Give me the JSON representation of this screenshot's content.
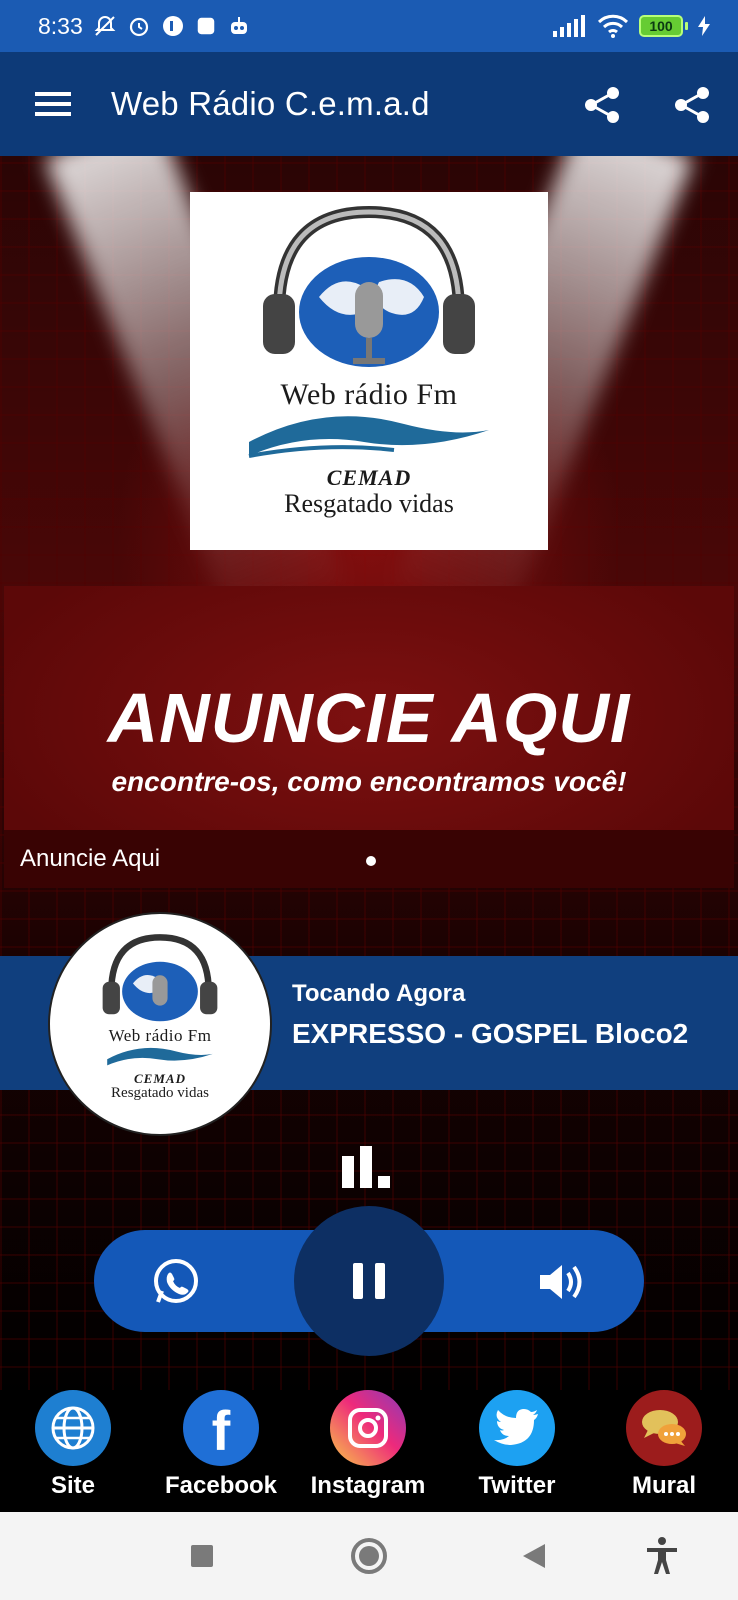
{
  "status_bar": {
    "time": "8:33",
    "battery": "100"
  },
  "app_bar": {
    "title": "Web Rádio C.e.m.a.d"
  },
  "logo": {
    "line1": "Web rádio  Fm",
    "line2": "CEMAD",
    "line3": "Resgatado vidas"
  },
  "banner": {
    "headline": "ANUNCIE AQUI",
    "subline": "encontre-os, como encontramos você!",
    "caption": "Anuncie Aqui"
  },
  "now_playing": {
    "label": "Tocando Agora",
    "title": "EXPRESSO - GOSPEL Bloco2"
  },
  "social": [
    {
      "label": "Site",
      "color": "#1e7fd1",
      "icon": "globe-icon"
    },
    {
      "label": "Facebook",
      "color": "#1f6fd6",
      "icon": "facebook-icon"
    },
    {
      "label": "Instagram",
      "color": "#e1306c",
      "icon": "instagram-icon"
    },
    {
      "label": "Twitter",
      "color": "#1da1f2",
      "icon": "twitter-icon"
    },
    {
      "label": "Mural",
      "color": "#9c1c1c",
      "icon": "chat-bubbles-icon"
    }
  ],
  "colors": {
    "status_bar": "#1b5bb3",
    "app_bar": "#0d3a78",
    "now_playing": "#103f7e",
    "controls": "#1458b8",
    "play_button": "#0d2f63"
  }
}
